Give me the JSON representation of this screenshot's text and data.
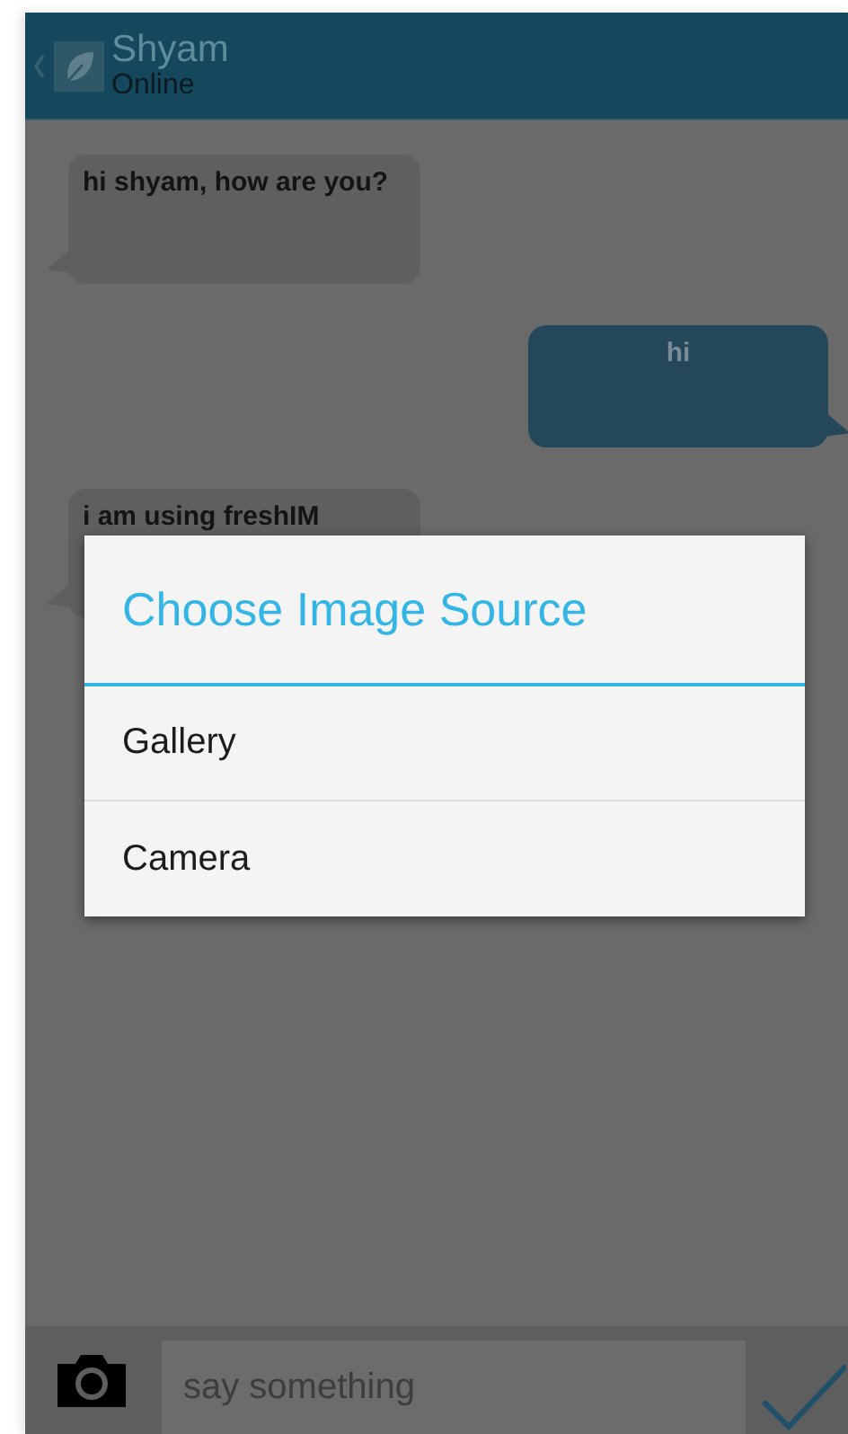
{
  "header": {
    "contact_name": "Shyam",
    "status": "Online"
  },
  "messages": [
    {
      "text": "hi shyam, how are you?",
      "kind": "incoming"
    },
    {
      "text": "hi",
      "kind": "outgoing"
    },
    {
      "text": "i am using freshIM",
      "kind": "incoming"
    }
  ],
  "dialog": {
    "title": "Choose Image Source",
    "options": [
      "Gallery",
      "Camera"
    ]
  },
  "composer": {
    "placeholder": "say something"
  }
}
